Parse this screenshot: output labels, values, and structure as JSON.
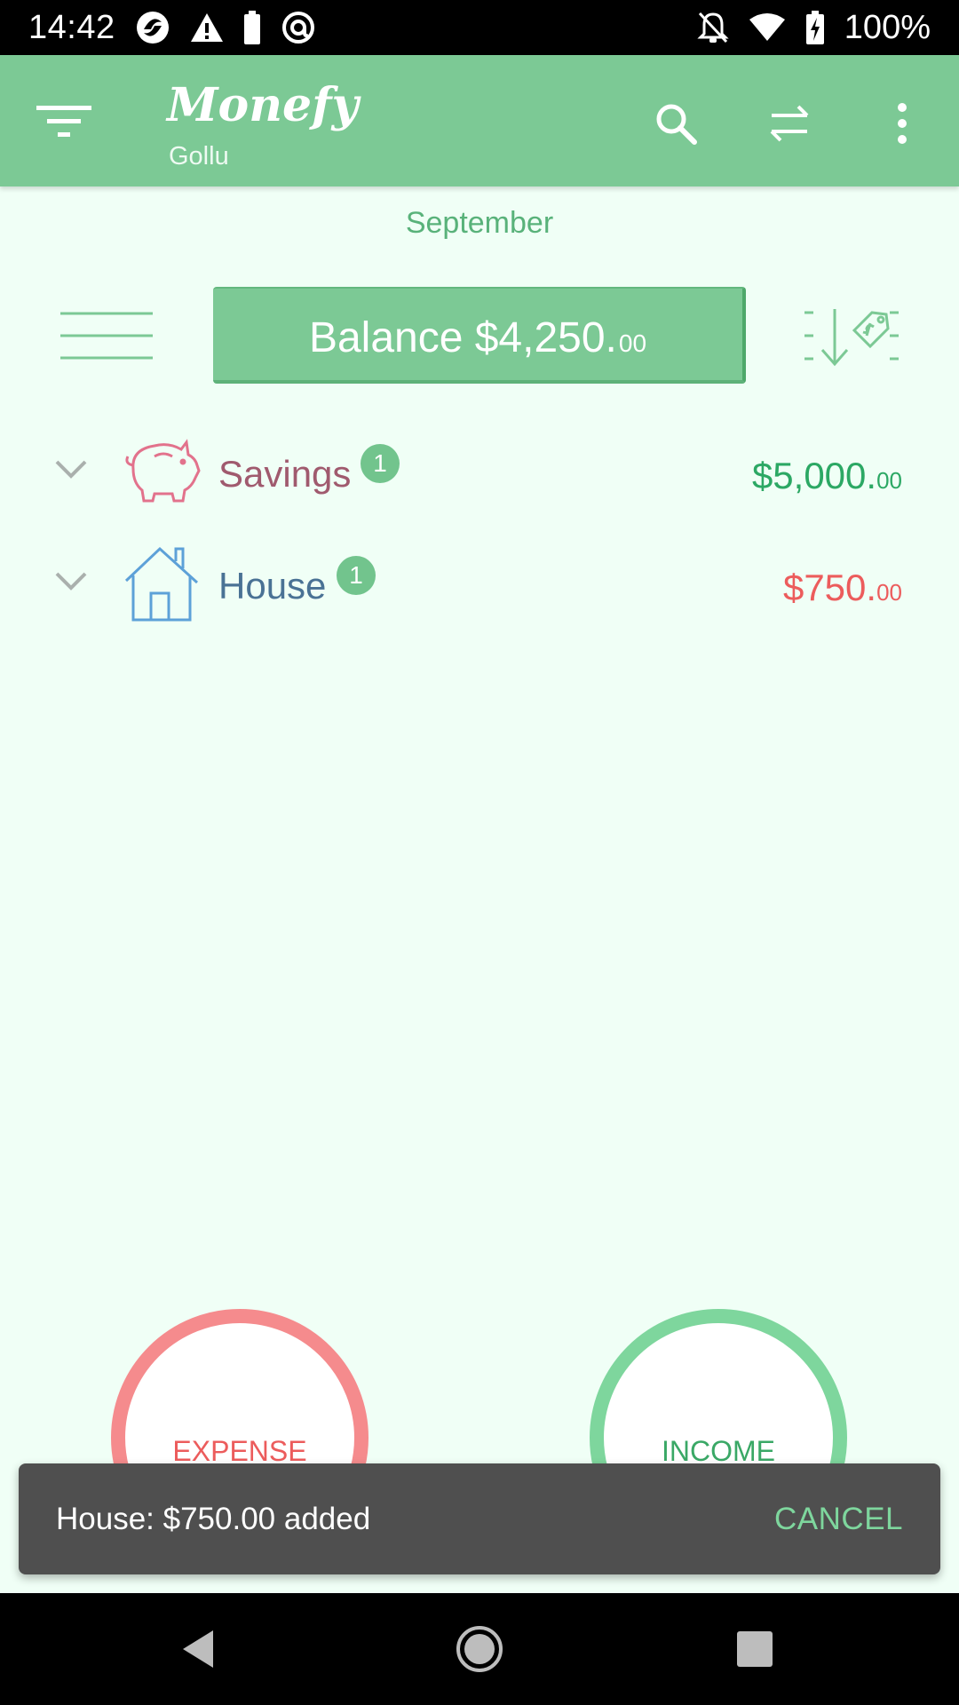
{
  "status_bar": {
    "time": "14:42",
    "battery": "100%",
    "icons_left": [
      "app-icon",
      "warning-icon",
      "battery-saver-icon",
      "at-sign-icon"
    ],
    "icons_right": [
      "mute-icon",
      "wifi-icon",
      "battery-charging-icon"
    ]
  },
  "app_bar": {
    "title": "Monefy",
    "subtitle": "Gollu",
    "actions": [
      "search-icon",
      "transfer-icon",
      "more-vert-icon"
    ]
  },
  "month": "September",
  "balance": {
    "label": "Balance $4,250.",
    "cents": "00"
  },
  "categories": [
    {
      "name": "Savings",
      "count": "1",
      "amount": "$5,000.",
      "cents": "00",
      "name_color": "#a05a6e",
      "amount_color": "#2ca864",
      "icon": "piggy-bank-icon"
    },
    {
      "name": "House",
      "count": "1",
      "amount": "$750.",
      "cents": "00",
      "name_color": "#4a7295",
      "amount_color": "#ec5c5c",
      "icon": "house-icon"
    }
  ],
  "buttons": {
    "expense": "EXPENSE",
    "income": "INCOME"
  },
  "snackbar": {
    "message": "House: $750.00 added",
    "action": "CANCEL"
  },
  "colors": {
    "primary": "#7cc995",
    "background": "#f0fff6",
    "expense": "#f58b8d",
    "income": "#7ed69d"
  }
}
